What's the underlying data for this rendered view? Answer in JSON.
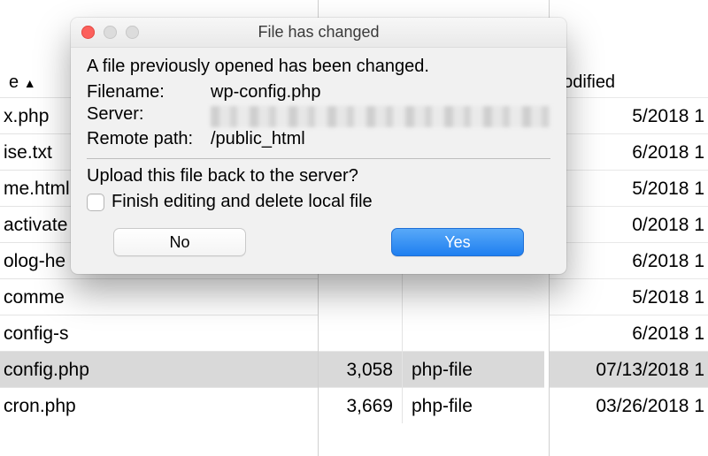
{
  "dialog": {
    "title": "File has changed",
    "message": "A file previously opened has been changed.",
    "labels": {
      "filename": "Filename:",
      "server": "Server:",
      "remote_path": "Remote path:"
    },
    "values": {
      "filename": "wp-config.php",
      "remote_path": "/public_html"
    },
    "prompt": "Upload this file back to the server?",
    "checkbox_label": "Finish editing and delete local file",
    "buttons": {
      "no": "No",
      "yes": "Yes"
    }
  },
  "bg_list": {
    "name_header": "e",
    "sort_indicator": "▲",
    "mod_header": "nodified",
    "filenames": [
      "x.php",
      "ise.txt",
      "me.html",
      "activate",
      "olog-he",
      "comme",
      "config-s",
      "config.php",
      "cron.php"
    ],
    "sizes": [
      "3,058",
      "3,669"
    ],
    "types": [
      "php-file",
      "php-file"
    ],
    "dates": [
      "5/2018",
      "6/2018",
      "5/2018",
      "0/2018",
      "6/2018",
      "5/2018",
      "6/2018",
      "07/13/2018",
      "03/26/2018"
    ],
    "date_suffix": "1"
  }
}
